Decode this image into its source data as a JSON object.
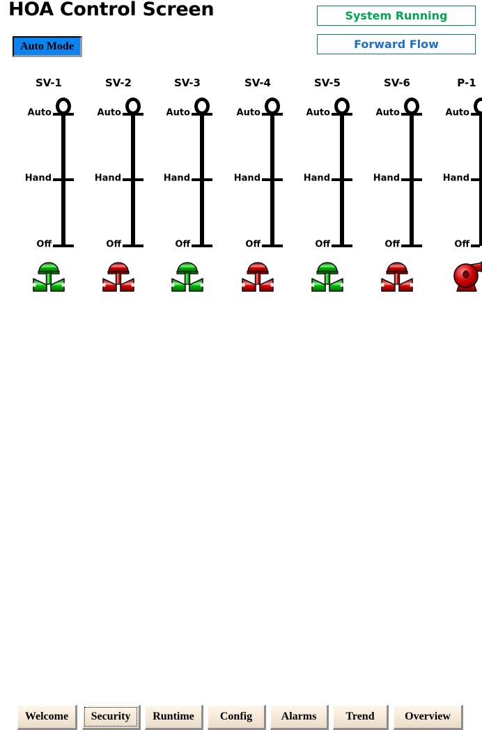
{
  "window": {
    "title": "HOA Control Screen",
    "background_color": "#ffffff"
  },
  "mode_button": {
    "label": "Auto Mode",
    "fill_color": "#0b84ef",
    "text_color": "#000000"
  },
  "status": {
    "system": {
      "label": "System Running",
      "text_color": "#00a651",
      "border_color": "#0e7c6c"
    },
    "flow": {
      "label": "Forward Flow",
      "text_color": "#1f6fc4",
      "border_color": "#0e7c6c"
    }
  },
  "switch_positions": {
    "auto": "Auto",
    "hand": "Hand",
    "off": "Off"
  },
  "devices": [
    {
      "tag": "SV-1",
      "type": "valve",
      "state": "open",
      "color": "#00b400",
      "switch": "Auto"
    },
    {
      "tag": "SV-2",
      "type": "valve",
      "state": "closed",
      "color": "#d00000",
      "switch": "Auto"
    },
    {
      "tag": "SV-3",
      "type": "valve",
      "state": "open",
      "color": "#00b400",
      "switch": "Auto"
    },
    {
      "tag": "SV-4",
      "type": "valve",
      "state": "closed",
      "color": "#d00000",
      "switch": "Auto"
    },
    {
      "tag": "SV-5",
      "type": "valve",
      "state": "open",
      "color": "#00b400",
      "switch": "Auto"
    },
    {
      "tag": "SV-6",
      "type": "valve",
      "state": "closed",
      "color": "#d00000",
      "switch": "Auto"
    },
    {
      "tag": "P-1",
      "type": "pump",
      "state": "closed",
      "color": "#d00000",
      "switch": "Auto"
    }
  ],
  "nav": {
    "buttons": [
      {
        "label": "Welcome",
        "focused": false
      },
      {
        "label": "Security",
        "focused": true
      },
      {
        "label": "Runtime",
        "focused": false
      },
      {
        "label": "Config",
        "focused": false
      },
      {
        "label": "Alarms",
        "focused": false
      },
      {
        "label": "Trend",
        "focused": false
      },
      {
        "label": "Overview",
        "focused": false
      }
    ]
  }
}
